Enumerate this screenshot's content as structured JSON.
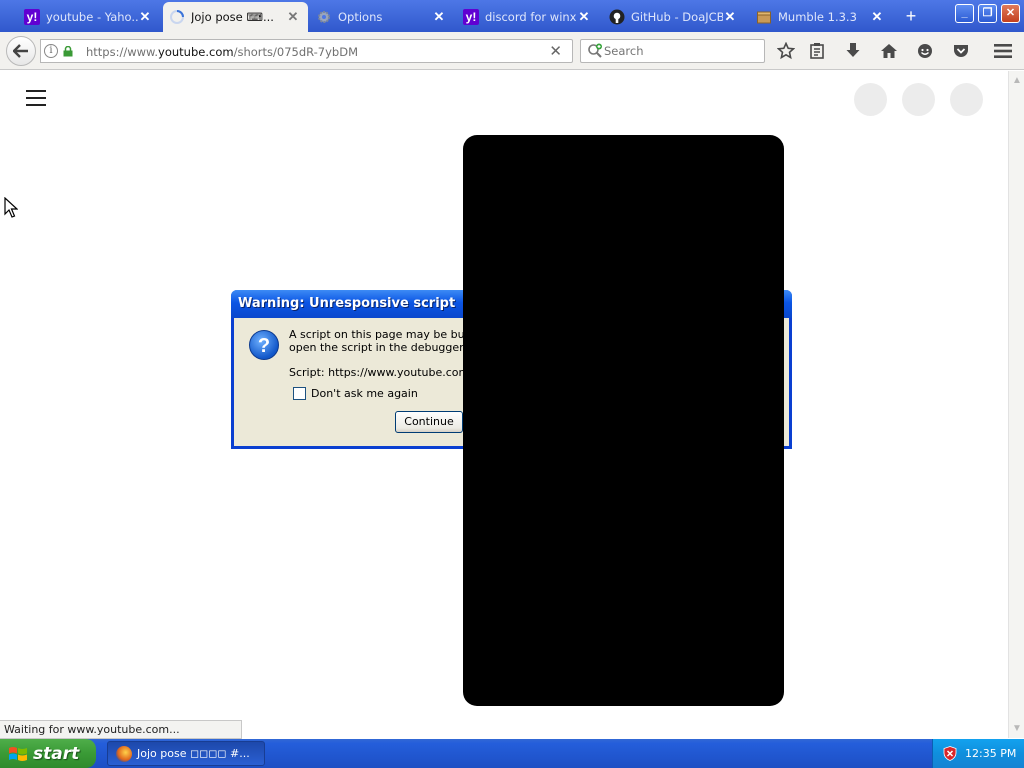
{
  "browser": {
    "tabs": [
      {
        "title": "youtube - Yaho...",
        "favicon": "yahoo-icon",
        "active": false
      },
      {
        "title": "Jojo pose ⌨...",
        "favicon": "loading-spinner-icon",
        "active": true
      },
      {
        "title": "Options",
        "favicon": "gear-icon",
        "active": false
      },
      {
        "title": "discord for winx...",
        "favicon": "yahoo-icon",
        "active": false
      },
      {
        "title": "GitHub - DoaJCB ...",
        "favicon": "github-icon",
        "active": false
      },
      {
        "title": "Mumble 1.3.3",
        "favicon": "package-icon",
        "active": false
      }
    ],
    "new_tab_label": "+",
    "url_prefix": "https://www.",
    "url_domain": "youtube.com",
    "url_path": "/shorts/075dR-7ybDM",
    "search_placeholder": "Search",
    "status_text": "Waiting for www.youtube.com..."
  },
  "dialog": {
    "title": "Warning: Unresponsive script",
    "message_line1": "A script on this page may be busy, c",
    "message_line2": "open the script in the debugger, or l",
    "script_label": "Script: https://www.youtube.com/s,",
    "checkbox_label": "Don't ask me again",
    "continue_label": "Continue"
  },
  "taskbar": {
    "start_label": "start",
    "window_label": "Jojo pose ◻◻◻◻ #...",
    "clock": "12:35 PM"
  },
  "colors": {
    "tabstrip": "#3a62d6",
    "dialog_title": "#0b55e4",
    "taskbar": "#245edb",
    "start": "#3a9a36"
  }
}
